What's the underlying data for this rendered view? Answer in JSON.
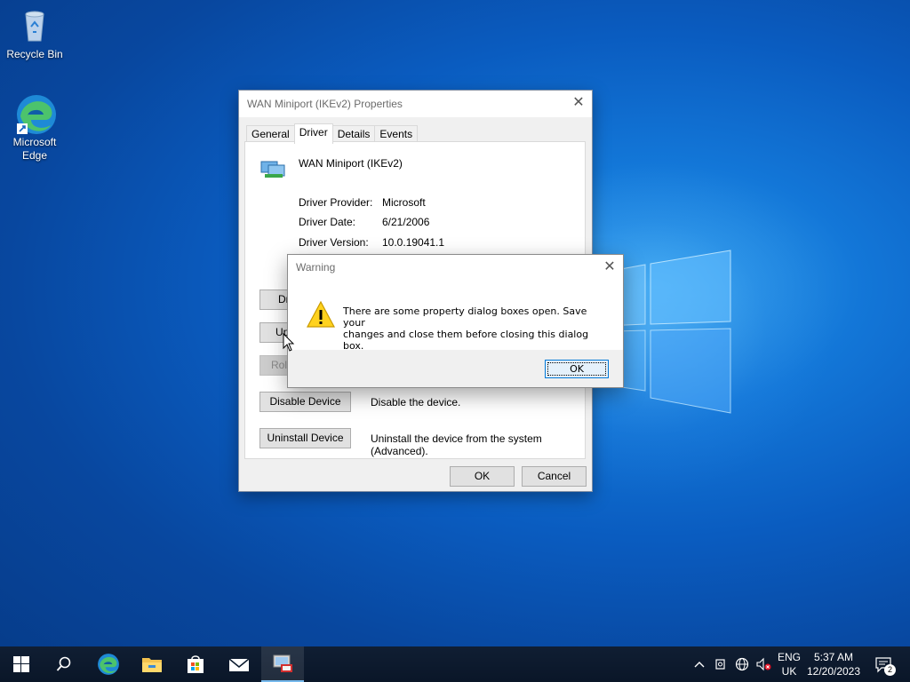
{
  "desktop": {
    "icons": [
      {
        "label": "Recycle Bin"
      },
      {
        "label": "Microsoft Edge"
      }
    ]
  },
  "properties_window": {
    "title": "WAN Miniport (IKEv2) Properties",
    "tabs": [
      "General",
      "Driver",
      "Details",
      "Events"
    ],
    "active_tab": "Driver",
    "device_name": "WAN Miniport (IKEv2)",
    "info": {
      "provider_label": "Driver Provider:",
      "provider_value": "Microsoft",
      "date_label": "Driver Date:",
      "date_value": "6/21/2006",
      "version_label": "Driver Version:",
      "version_value": "10.0.19041.1"
    },
    "buttons": {
      "driver_details": "Dri",
      "update_driver": "Up",
      "roll_back": "Roll",
      "disable_device": "Disable Device",
      "disable_desc": "Disable the device.",
      "uninstall_device": "Uninstall Device",
      "uninstall_desc": "Uninstall the device from the system (Advanced).",
      "ok": "OK",
      "cancel": "Cancel"
    }
  },
  "warning_dialog": {
    "title": "Warning",
    "message_line1": "There are some property dialog boxes open. Save your",
    "message_line2": "changes and close them before closing this dialog box.",
    "ok_label": "OK"
  },
  "taskbar": {
    "language_line1": "ENG",
    "language_line2": "UK",
    "time": "5:37 AM",
    "date": "12/20/2023",
    "notification_count": "2",
    "pinned": [
      "start-icon",
      "search-icon",
      "edge-icon",
      "file-explorer-icon",
      "store-icon",
      "mail-icon",
      "device-manager-icon"
    ]
  },
  "colors": {
    "accent": "#0078d7",
    "taskbar": "#0b1a2e",
    "desktop": "#0a5cc0"
  }
}
